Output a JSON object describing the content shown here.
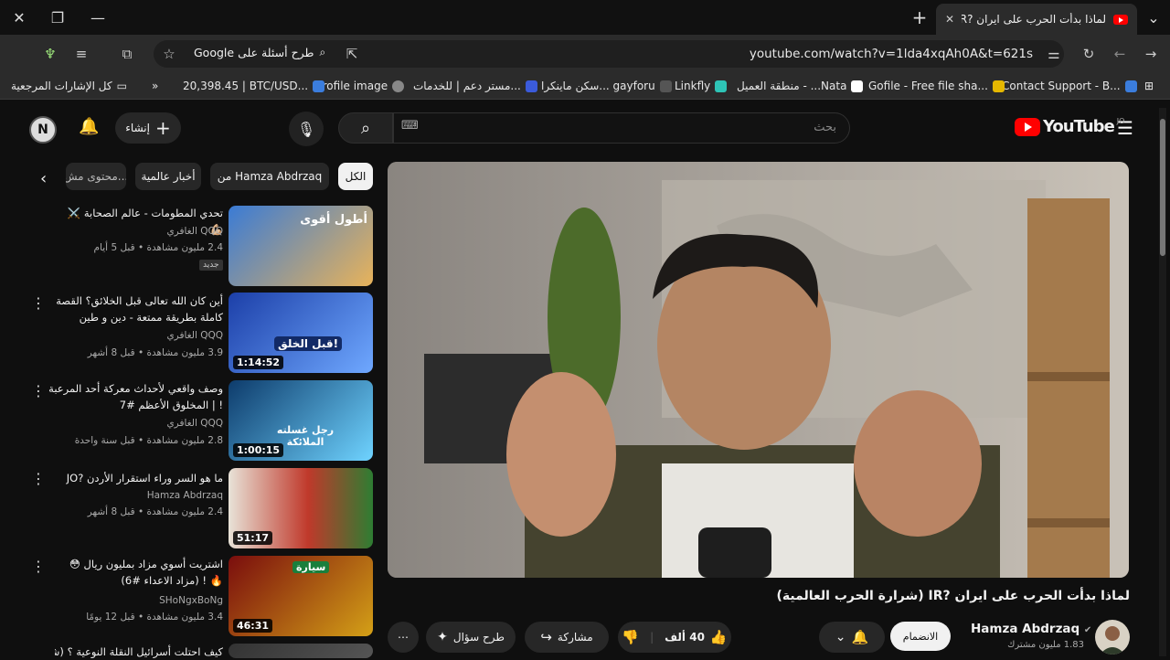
{
  "browser": {
    "tab_title": "لماذا بدأت الحرب على ايران ?IR (ش",
    "url": "youtube.com/watch?v=1lda4xqAh0A&t=621s",
    "google_prompt": "طرح أسئلة على Google"
  },
  "bookmarks": [
    {
      "label": "Contact Support - B...",
      "color": "#3b7ddd"
    },
    {
      "label": "Gofile - Free file sha...",
      "color": "#e6b800"
    },
    {
      "label": "منطقة العميل - ...Nata",
      "color": "#ffffff"
    },
    {
      "label": "Linkfly",
      "color": "#2ec4b6"
    },
    {
      "label": "سكن ماينكرا... gayforu",
      "color": "#555555"
    },
    {
      "label": "مستر دعم | للخدمات...",
      "color": "#3b5bdb"
    },
    {
      "label": "profile image",
      "color": "#888888"
    },
    {
      "label": "20,398.45 | BTC/USD...",
      "color": "#3b7ddd"
    },
    {
      "label": "كل الإشارات المرجعية",
      "color": "#cccccc"
    }
  ],
  "youtube": {
    "logo_text": "YouTube",
    "country": "JO",
    "search_placeholder": "بحث",
    "create_label": "إنشاء",
    "avatar_letter": "N",
    "chips": [
      "الكل",
      "من Hamza Abdrzaq",
      "أخبار عالمية",
      "محتوى مش..."
    ]
  },
  "video": {
    "title": "لماذا بدأت الحرب على ايران ?IR (شرارة الحرب العالمية)",
    "channel": "Hamza Abdrzaq",
    "subscribers": "1.83 مليون مشترك",
    "join_label": "الانضمام",
    "likes": "40 ألف",
    "share_label": "مشاركة",
    "ask_label": "طرح سؤال"
  },
  "related": [
    {
      "title": "تحدي المطومات - عالم الصحابة ⚔️ 💪🏼",
      "channel": "QQQ الغافري",
      "meta": "2.4 مليون مشاهدة • قبل 5 أيام",
      "badge": "جديد",
      "duration": "",
      "thumb_text": "أطول أقوى",
      "colors": [
        "#3a7bd5",
        "#e8b35a"
      ]
    },
    {
      "title": "أين كان الله تعالى قبل الخلائق؟ القصة كاملة بطريقة ممتعة - دين و طين",
      "channel": "QQQ الغافري",
      "meta": "3.9 مليون مشاهدة • قبل 8 أشهر",
      "badge": "",
      "duration": "1:14:52",
      "thumb_text": "قبل الخلق!",
      "colors": [
        "#1c3fa8",
        "#6fa8ff"
      ]
    },
    {
      "title": "وصف واقعي لأحداث معركة أحد المرعبة ! | المخلوق الأعظم #7",
      "channel": "QQQ الغافري",
      "meta": "2.8 مليون مشاهدة • قبل سنة واحدة",
      "badge": "",
      "duration": "1:00:15",
      "thumb_text": "رجل غسلته الملائكة",
      "colors": [
        "#0d3b6b",
        "#6fd3ff"
      ]
    },
    {
      "title": "ما هو السر وراء استقرار الأردن ?JO",
      "channel": "Hamza Abdrzaq",
      "meta": "2.4 مليون مشاهدة • قبل 8 أشهر",
      "badge": "",
      "duration": "51:17",
      "thumb_text": "",
      "colors": [
        "#c0392b",
        "#2e7d32"
      ]
    },
    {
      "title": "اشتريت أسوي مزاد بمليون ريال 😳 🔥 ! (مزاد الاعداء #6)",
      "channel": "SHoNgxBoNg",
      "meta": "3.4 مليون مشاهدة • قبل 12 يومًا",
      "badge": "",
      "duration": "46:31",
      "thumb_text": "سيارة",
      "colors": [
        "#7a0d0d",
        "#d4a017"
      ]
    },
    {
      "title": "كيف احتلت أسرائيل النقلة النوعية ؟ (شكل",
      "channel": "",
      "meta": "",
      "badge": "",
      "duration": "",
      "thumb_text": "",
      "colors": [
        "#333333",
        "#555555"
      ]
    }
  ],
  "colors": {
    "accent": "#ff0000",
    "bg": "#0f0f0f",
    "pill": "#272727"
  }
}
